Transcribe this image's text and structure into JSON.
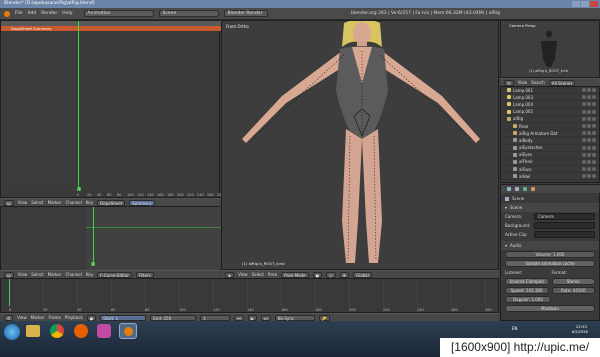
{
  "window": {
    "title": "Blender* [D:\\apekasane\\Pig\\alRig.blend]"
  },
  "menubar": {
    "items": [
      "File",
      "Add",
      "Render",
      "Help"
    ],
    "screen_select": "Animation",
    "scene_select": "Scene",
    "engine_select": "Blender Render",
    "info": "blender.org 263 | Ve:6/257 | Fa:n/a | Mem:66.32M (43.04M) | alRig"
  },
  "dopesheet": {
    "summary_label": "DopeSheet Summary",
    "frame_ticks": [
      "0",
      "20",
      "40",
      "60",
      "80",
      "100",
      "120",
      "140",
      "160",
      "180",
      "200",
      "220",
      "240",
      "260",
      "280"
    ],
    "current_frame": "1",
    "header": {
      "menus": [
        "View",
        "Select",
        "Marker",
        "Channel",
        "Key"
      ],
      "mode": "DopeSheet",
      "summary_btn": "Summary"
    }
  },
  "graph_editor": {
    "header": {
      "menus": [
        "View",
        "Select",
        "Marker",
        "Channel",
        "Key"
      ],
      "mode": "F-Curve Editor",
      "filters": "Filters"
    },
    "current_frame": "1"
  },
  "viewport": {
    "label": "Front Ortho",
    "object_label": "(1) alRig b_ROOT_tcrsl",
    "header": {
      "menus": [
        "View",
        "Select",
        "Pose"
      ],
      "mode": "Pose Mode",
      "orientation": "Global"
    }
  },
  "camera_persp": {
    "label": "Camera Persp",
    "object_label": "(1) alRig b_ROOT_tcrsl"
  },
  "outliner": {
    "header": {
      "menus": [
        "View",
        "Search"
      ],
      "filter": "All Scenes"
    },
    "items": [
      {
        "label": "Lamp.001",
        "type": "light"
      },
      {
        "label": "Lamp.003",
        "type": "light"
      },
      {
        "label": "Lamp.004",
        "type": "light"
      },
      {
        "label": "Lamp.005",
        "type": "light"
      },
      {
        "label": "alRig",
        "type": "arm"
      },
      {
        "label": "Pose",
        "type": "arm"
      },
      {
        "label": "alRig Armature Dat",
        "type": "arm"
      },
      {
        "label": "alBody",
        "type": "mesh"
      },
      {
        "label": "alEyelashes",
        "type": "mesh"
      },
      {
        "label": "alEyes",
        "type": "mesh"
      },
      {
        "label": "alFhair",
        "type": "mesh"
      },
      {
        "label": "alFace",
        "type": "mesh"
      },
      {
        "label": "alHair",
        "type": "mesh"
      }
    ]
  },
  "properties": {
    "breadcrumb": "Scene",
    "section_scene": "Scene",
    "camera_label": "Camera:",
    "camera_value": "Camera",
    "background_label": "Background:",
    "active_clip_label": "Active Clip:",
    "section_audio": "Audio",
    "volume": "Volume: 1.000",
    "update_cache": "Update animation cache",
    "listener_label": "Listener:",
    "format_label": "Format:",
    "distance_model": "Inverse Clamped",
    "format_value": "Stereo",
    "speed": "Speed: 343.300",
    "rate": "Rate: 44100",
    "doppler": "Doppler: 1.000",
    "mixdown": "Mixdown"
  },
  "timeline": {
    "ticks": [
      "0",
      "20",
      "40",
      "60",
      "80",
      "100",
      "120",
      "140",
      "160",
      "180",
      "200",
      "220",
      "240",
      "260",
      "280"
    ],
    "header": {
      "menus": [
        "View",
        "Marker",
        "Frame",
        "Playback"
      ],
      "start": "Start: 1",
      "end": "End: 250",
      "current": "1",
      "sync": "No Sync"
    }
  },
  "taskbar": {
    "lang": "EN",
    "time": "22:53",
    "date": "6/5/2556"
  },
  "watermark": "[1600x900] http://upic.me/",
  "colors": {
    "accent_orange": "#d4522c",
    "green_frame": "#3fd33f",
    "title_blue": "#6b85a8"
  }
}
